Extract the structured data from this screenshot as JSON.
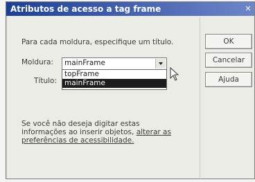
{
  "window": {
    "title": "Atributos de acesso a tag frame"
  },
  "form": {
    "instruction": "Para cada moldura, especifique um título.",
    "moldura_label": "Moldura:",
    "moldura_value": "mainFrame",
    "moldura_options": [
      "topFrame",
      "mainFrame"
    ],
    "titulo_label": "Título:"
  },
  "buttons": {
    "ok": "OK",
    "cancel": "Cancelar",
    "help": "Ajuda"
  },
  "info": {
    "text": "Se você não deseja digitar estas informações ao inserir objetos, ",
    "link": "alterar as preferências de acessibilidade."
  }
}
